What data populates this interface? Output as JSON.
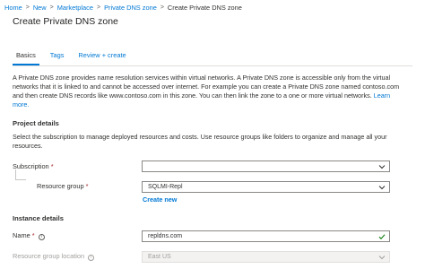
{
  "breadcrumb": {
    "items": [
      "Home",
      "New",
      "Marketplace",
      "Private DNS zone"
    ],
    "current": "Create Private DNS zone"
  },
  "page_title": "Create Private DNS zone",
  "tabs": [
    {
      "label": "Basics",
      "active": true
    },
    {
      "label": "Tags",
      "active": false
    },
    {
      "label": "Review + create",
      "active": false
    }
  ],
  "intro": {
    "text": "A Private DNS zone provides name resolution services within virtual networks. A Private DNS zone is accessible only from the virtual networks that it is linked to and cannot be accessed over internet. For example you can create a Private DNS zone named contoso.com and then create DNS records like www.contoso.com in this zone. You can then link the zone to a one or more virtual networks.",
    "learn_more": "Learn more."
  },
  "project_details": {
    "title": "Project details",
    "description": "Select the subscription to manage deployed resources and costs. Use resource groups like folders to organize and manage all your resources.",
    "subscription": {
      "label": "Subscription",
      "required": "*",
      "value": ""
    },
    "resource_group": {
      "label": "Resource group",
      "required": "*",
      "value": "SQLMI-Repl",
      "create_new": "Create new"
    }
  },
  "instance_details": {
    "title": "Instance details",
    "name": {
      "label": "Name",
      "required": "*",
      "value": "repldns.com",
      "info_glyph": "i"
    },
    "location": {
      "label": "Resource group location",
      "value": "East US",
      "info_glyph": "i"
    }
  },
  "colors": {
    "accent": "#0078d4",
    "required": "#a4262c",
    "valid": "#107c10"
  },
  "icons": [
    "chevron-down-icon",
    "info-icon",
    "checkmark-icon",
    "chevron-right-icon"
  ]
}
